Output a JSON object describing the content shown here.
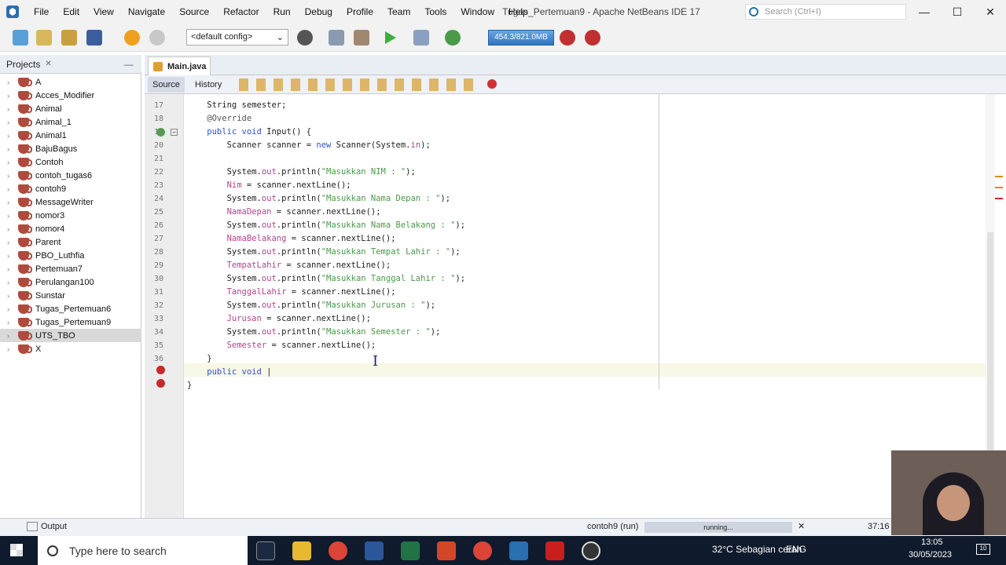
{
  "menubar": {
    "items": [
      "File",
      "Edit",
      "View",
      "Navigate",
      "Source",
      "Refactor",
      "Run",
      "Debug",
      "Profile",
      "Team",
      "Tools",
      "Window",
      "Help"
    ],
    "title": "Tugas_Pertemuan9 - Apache NetBeans IDE 17",
    "search_placeholder": "Search (Ctrl+I)"
  },
  "window_controls": {
    "minimize": "—",
    "maximize": "☐",
    "close": "✕"
  },
  "toolbar": {
    "config": "<default config>",
    "memory": "454.3/821.0MB"
  },
  "projects": {
    "tab_label": "Projects",
    "close": "✕",
    "minimize": "—",
    "items": [
      "A",
      "Acces_Modifier",
      "Animal",
      "Animal_1",
      "Animal1",
      "BajuBagus",
      "Contoh",
      "contoh_tugas6",
      "contoh9",
      "MessageWriter",
      "nomor3",
      "nomor4",
      "Parent",
      "PBO_Luthfia",
      "Pertemuan7",
      "Perulangan100",
      "Sunstar",
      "Tugas_Pertemuan6",
      "Tugas_Pertemuan9",
      "UTS_TBO",
      "X"
    ],
    "selected": "UTS_TBO"
  },
  "editor": {
    "tab": "Main.java",
    "source_label": "Source",
    "history_label": "History",
    "lines": [
      {
        "n": "17",
        "parts": [
          [
            "t",
            "    "
          ],
          [
            "t",
            "String semester;"
          ]
        ]
      },
      {
        "n": "18",
        "parts": [
          [
            "a",
            "    @Override"
          ]
        ]
      },
      {
        "n": "19",
        "parts": [
          [
            "k",
            "    public void "
          ],
          [
            "t",
            "Input() {"
          ]
        ]
      },
      {
        "n": "20",
        "parts": [
          [
            "t",
            "        Scanner scanner = "
          ],
          [
            "k",
            "new"
          ],
          [
            "t",
            " Scanner(System."
          ],
          [
            "f",
            "in"
          ],
          [
            "t",
            ");"
          ]
        ]
      },
      {
        "n": "21",
        "parts": []
      },
      {
        "n": "22",
        "parts": [
          [
            "t",
            "        System."
          ],
          [
            "f",
            "out"
          ],
          [
            "t",
            ".println("
          ],
          [
            "s",
            "\"Masukkan NIM : \""
          ],
          [
            "t",
            ");"
          ]
        ]
      },
      {
        "n": "23",
        "parts": [
          [
            "f",
            "        Nim"
          ],
          [
            "t",
            " = scanner.nextLine();"
          ]
        ]
      },
      {
        "n": "24",
        "parts": [
          [
            "t",
            "        System."
          ],
          [
            "f",
            "out"
          ],
          [
            "t",
            ".println("
          ],
          [
            "s",
            "\"Masukkan Nama Depan : \""
          ],
          [
            "t",
            ");"
          ]
        ]
      },
      {
        "n": "25",
        "parts": [
          [
            "f",
            "        NamaDepan"
          ],
          [
            "t",
            " = scanner.nextLine();"
          ]
        ]
      },
      {
        "n": "26",
        "parts": [
          [
            "t",
            "        System."
          ],
          [
            "f",
            "out"
          ],
          [
            "t",
            ".println("
          ],
          [
            "s",
            "\"Masukkan Nama Belakang : \""
          ],
          [
            "t",
            ");"
          ]
        ]
      },
      {
        "n": "27",
        "parts": [
          [
            "f",
            "        NamaBelakang"
          ],
          [
            "t",
            " = scanner.nextLine();"
          ]
        ]
      },
      {
        "n": "28",
        "parts": [
          [
            "t",
            "        System."
          ],
          [
            "f",
            "out"
          ],
          [
            "t",
            ".println("
          ],
          [
            "s",
            "\"Masukkan Tempat Lahir : \""
          ],
          [
            "t",
            ");"
          ]
        ]
      },
      {
        "n": "29",
        "parts": [
          [
            "f",
            "        TempatLahir"
          ],
          [
            "t",
            " = scanner.nextLine();"
          ]
        ]
      },
      {
        "n": "30",
        "parts": [
          [
            "t",
            "        System."
          ],
          [
            "f",
            "out"
          ],
          [
            "t",
            ".println("
          ],
          [
            "s",
            "\"Masukkan Tanggal Lahir : \""
          ],
          [
            "t",
            ");"
          ]
        ]
      },
      {
        "n": "31",
        "parts": [
          [
            "f",
            "        TanggalLahir"
          ],
          [
            "t",
            " = scanner.nextLine();"
          ]
        ]
      },
      {
        "n": "32",
        "parts": [
          [
            "t",
            "        System."
          ],
          [
            "f",
            "out"
          ],
          [
            "t",
            ".println("
          ],
          [
            "s",
            "\"Masukkan Jurusan : \""
          ],
          [
            "t",
            ");"
          ]
        ]
      },
      {
        "n": "33",
        "parts": [
          [
            "f",
            "        Jurusan"
          ],
          [
            "t",
            " = scanner.nextLine();"
          ]
        ]
      },
      {
        "n": "34",
        "parts": [
          [
            "t",
            "        System."
          ],
          [
            "f",
            "out"
          ],
          [
            "t",
            ".println("
          ],
          [
            "s",
            "\"Masukkan Semester : \""
          ],
          [
            "t",
            ");"
          ]
        ]
      },
      {
        "n": "35",
        "parts": [
          [
            "f",
            "        Semester"
          ],
          [
            "t",
            " = scanner.nextLine();"
          ]
        ]
      },
      {
        "n": "36",
        "parts": [
          [
            "t",
            "    }"
          ]
        ]
      },
      {
        "n": "",
        "parts": [
          [
            "k",
            "    public void "
          ],
          [
            "t",
            "|"
          ]
        ]
      },
      {
        "n": "",
        "parts": [
          [
            "t",
            "}"
          ]
        ]
      }
    ]
  },
  "statusbar": {
    "output": "Output",
    "run": "contoh9 (run)",
    "progress": "running...",
    "close": "✕",
    "position": "37:16"
  },
  "taskbar": {
    "search": "Type here to search",
    "weather": "32°C  Sebagian cerah",
    "lang": "ENG",
    "time": "13:05",
    "date": "30/05/2023",
    "notif": "10"
  }
}
